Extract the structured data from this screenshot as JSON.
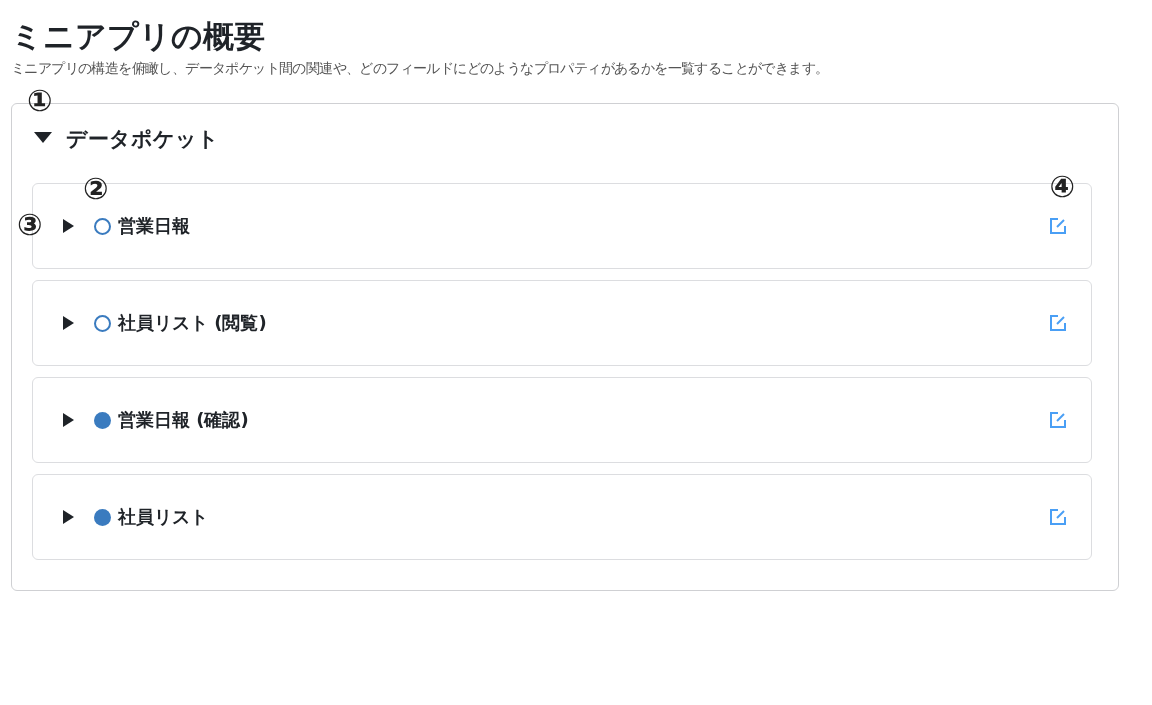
{
  "title": "ミニアプリの概要",
  "description": "ミニアプリの構造を俯瞰し、データポケット間の関連や、どのフィールドにどのようなプロパティがあるかを一覧することができます。",
  "section": {
    "title": "データポケット",
    "expanded": true,
    "annotation": "①",
    "items": [
      {
        "name": "営業日報",
        "expanded": false,
        "kind": "outline",
        "annotations": {
          "dot": "②",
          "row": "③",
          "edit": "④"
        }
      },
      {
        "name": "社員リスト (閲覧)",
        "expanded": false,
        "kind": "outline"
      },
      {
        "name": "営業日報 (確認)",
        "expanded": false,
        "kind": "filled"
      },
      {
        "name": "社員リスト",
        "expanded": false,
        "kind": "filled"
      }
    ]
  }
}
